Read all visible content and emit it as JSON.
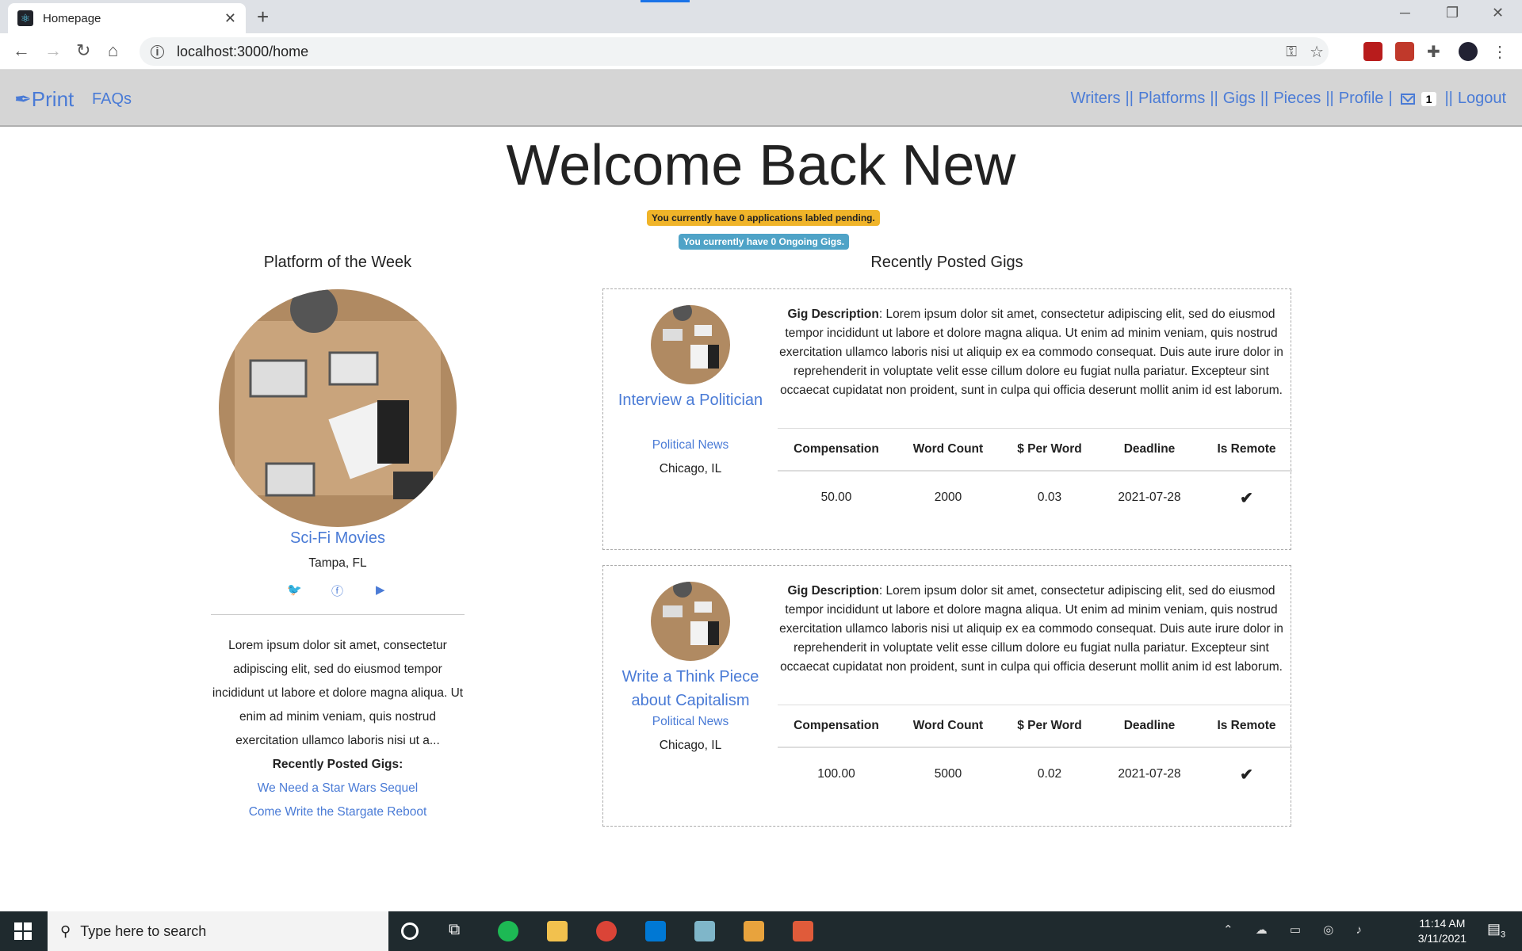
{
  "browser": {
    "tab_title": "Homepage",
    "url": "localhost:3000/home"
  },
  "nav": {
    "brand": "Print",
    "faqs": "FAQs",
    "links": [
      "Writers",
      "Platforms",
      "Gigs",
      "Pieces",
      "Profile"
    ],
    "separator": "||",
    "message_count": "1",
    "logout": "Logout"
  },
  "welcome": "Welcome Back New",
  "alerts": {
    "pending": "You currently have 0 applications labled pending.",
    "ongoing": "You currently have 0 Ongoing Gigs."
  },
  "platform_of_week": {
    "heading": "Platform of the Week",
    "name": "Sci-Fi Movies",
    "location": "Tampa, FL",
    "description": "Lorem ipsum dolor sit amet, consectetur adipiscing elit, sed do eiusmod tempor incididunt ut labore et dolore magna aliqua. Ut enim ad minim veniam, quis nostrud exercitation ullamco laboris nisi ut a...",
    "recent_gigs_label": "Recently Posted Gigs:",
    "recent_gigs": [
      "We Need a Star Wars Sequel",
      "Come Write the Stargate Reboot"
    ]
  },
  "recent_gigs": {
    "heading": "Recently Posted Gigs",
    "desc_label": "Gig Description",
    "columns": [
      "Compensation",
      "Word Count",
      "$ Per Word",
      "Deadline",
      "Is Remote"
    ],
    "items": [
      {
        "title": "Interview a Politician",
        "platform": "Political News",
        "location": "Chicago, IL",
        "description": ": Lorem ipsum dolor sit amet, consectetur adipiscing elit, sed do eiusmod tempor incididunt ut labore et dolore magna aliqua. Ut enim ad minim veniam, quis nostrud exercitation ullamco laboris nisi ut aliquip ex ea commodo consequat. Duis aute irure dolor in reprehenderit in voluptate velit esse cillum dolore eu fugiat nulla pariatur. Excepteur sint occaecat cupidatat non proident, sunt in culpa qui officia deserunt mollit anim id est laborum.",
        "compensation": "50.00",
        "word_count": "2000",
        "per_word": "0.03",
        "deadline": "2021-07-28",
        "is_remote": "✔"
      },
      {
        "title": "Write a Think Piece about Capitalism",
        "platform": "Political News",
        "location": "Chicago, IL",
        "description": ": Lorem ipsum dolor sit amet, consectetur adipiscing elit, sed do eiusmod tempor incididunt ut labore et dolore magna aliqua. Ut enim ad minim veniam, quis nostrud exercitation ullamco laboris nisi ut aliquip ex ea commodo consequat. Duis aute irure dolor in reprehenderit in voluptate velit esse cillum dolore eu fugiat nulla pariatur. Excepteur sint occaecat cupidatat non proident, sunt in culpa qui officia deserunt mollit anim id est laborum.",
        "compensation": "100.00",
        "word_count": "5000",
        "per_word": "0.02",
        "deadline": "2021-07-28",
        "is_remote": "✔"
      }
    ]
  },
  "taskbar": {
    "search_placeholder": "Type here to search",
    "time": "11:14 AM",
    "date": "3/11/2021",
    "notifications": "3"
  },
  "colors": {
    "link": "#4a7bd6",
    "nav_bg": "#d5d5d5",
    "warning": "#f0b429",
    "info": "#4fa3c7",
    "check": "#2a9d3a"
  }
}
